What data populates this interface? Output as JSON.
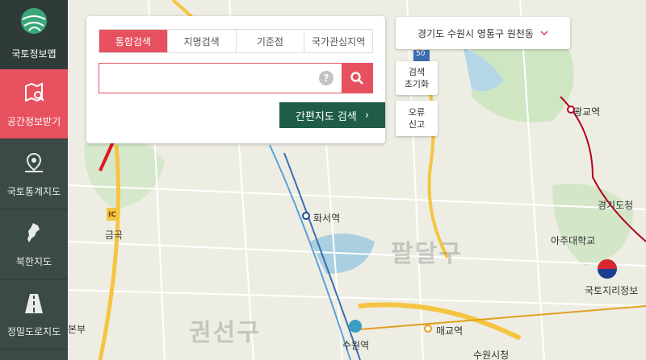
{
  "sidebar": {
    "logo_label": "국토정보맵",
    "items": [
      {
        "label": "공간정보받기",
        "active": true,
        "icon": "map-search-icon"
      },
      {
        "label": "국토통계지도",
        "active": false,
        "icon": "map-pin-icon"
      },
      {
        "label": "북한지도",
        "active": false,
        "icon": "korea-peninsula-icon"
      },
      {
        "label": "정밀도로지도",
        "active": false,
        "icon": "road-icon"
      }
    ]
  },
  "search_panel": {
    "tabs": [
      "통합검색",
      "지명검색",
      "기준점",
      "국가관심지역"
    ],
    "active_tab": "통합검색",
    "search_value": "",
    "help_symbol": "?",
    "easy_search_label": "간편지도 검색",
    "easy_search_chevron": "›"
  },
  "region_select": {
    "value": "경기도 수원시 영통구 원천동"
  },
  "controls": {
    "reset_line1": "검색",
    "reset_line2": "초기화",
    "report_line1": "오류",
    "report_line2": "신고"
  },
  "map_labels": {
    "gwanggyo": "광교역",
    "hwaseo": "화서역",
    "geumgok": "금곡",
    "ic": "IC",
    "ajou": "아주대학교",
    "gyeonggi": "경기도청",
    "ngii": "국토지리정보",
    "maegyo": "매교역",
    "suwon": "수원역",
    "suwon_city": "수원시청",
    "bonbu": "본부",
    "district_paldal": "팔달구",
    "district_gwonseon": "권선구",
    "road_50": "50"
  },
  "colors": {
    "accent": "#e7515f",
    "sidebar_bg": "#3c4a47",
    "easy_btn": "#1f5d48"
  }
}
